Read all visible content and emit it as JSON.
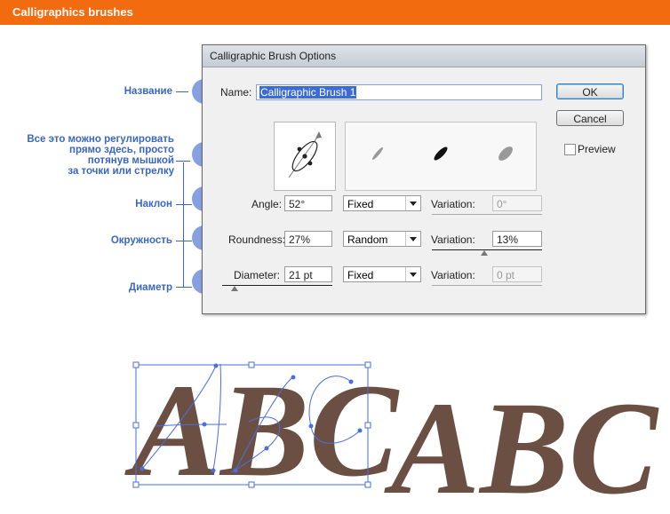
{
  "banner": {
    "title": "Calligraphics brushes",
    "color": "#f26b0f"
  },
  "annotations": {
    "name": "Название",
    "adjust_line1": "Все это можно регулировать",
    "adjust_line2": "прямо здесь, просто",
    "adjust_line3": "потянув мышкой",
    "adjust_line4": "за точки или стрелку",
    "angle": "Наклон",
    "roundness": "Окружность",
    "diameter": "Диаметр",
    "accent": "#3a66c4"
  },
  "dialog": {
    "title": "Calligraphic Brush Options",
    "name_label": "Name:",
    "name_value": "Calligraphic Brush 1",
    "ok": "OK",
    "cancel": "Cancel",
    "preview": "Preview",
    "preview_checked": false,
    "angle": {
      "label": "Angle:",
      "value": "52°",
      "mode": "Fixed",
      "variation_label": "Variation:",
      "variation": "0°"
    },
    "roundness": {
      "label": "Roundness:",
      "value": "27%",
      "mode": "Random",
      "variation_label": "Variation:",
      "variation": "13%"
    },
    "diameter": {
      "label": "Diameter:",
      "value": "21 pt",
      "mode": "Fixed",
      "variation_label": "Variation:",
      "variation": "0 pt"
    }
  },
  "sample_text": {
    "left": "ABC",
    "right": "ABC",
    "color": "#6b4f43"
  }
}
